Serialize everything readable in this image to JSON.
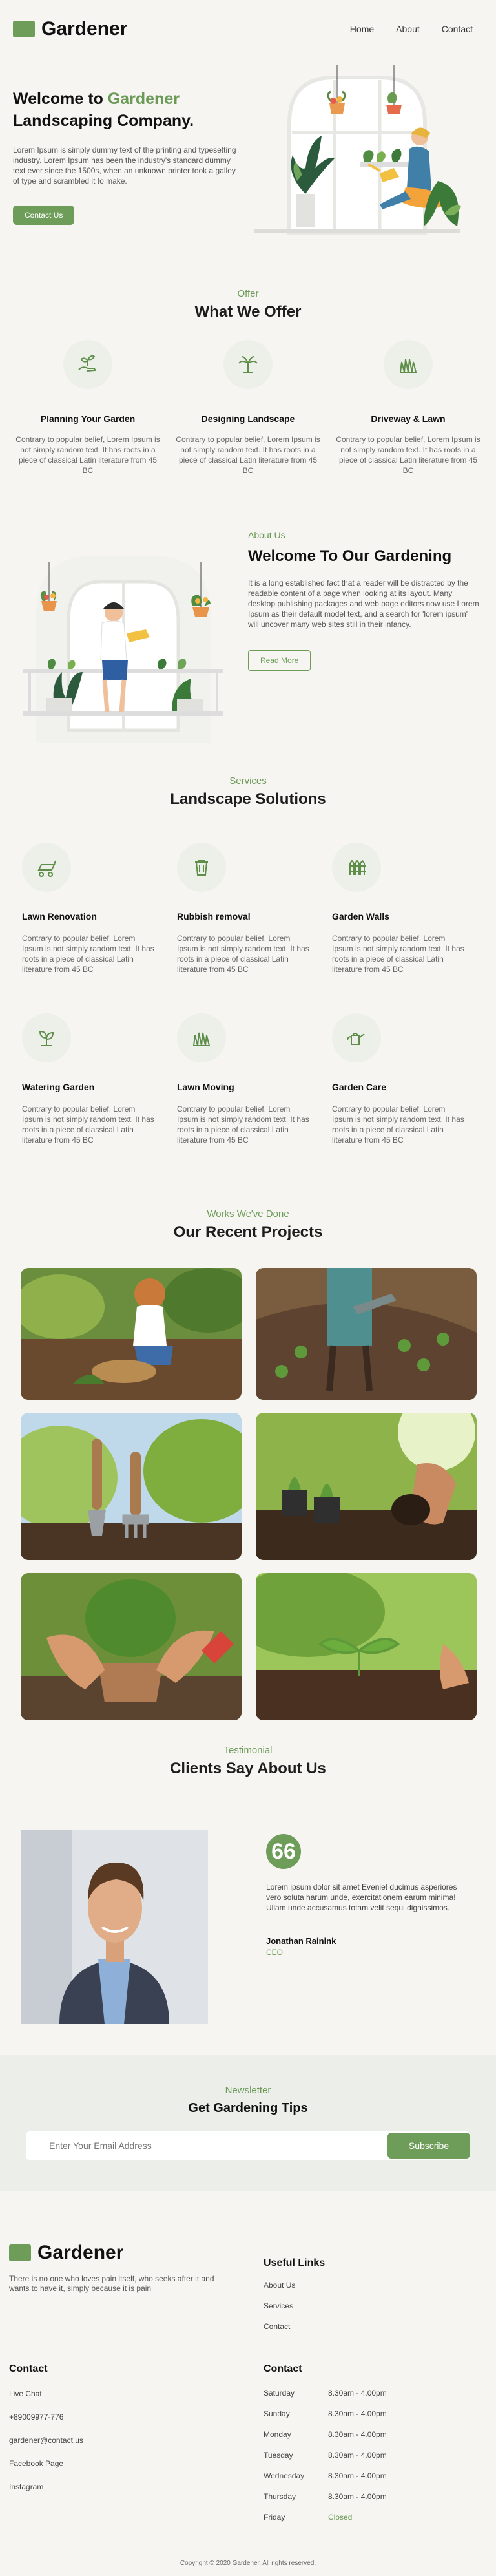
{
  "header": {
    "brand": "Gardener",
    "nav": [
      "Home",
      "About",
      "Contact"
    ]
  },
  "hero": {
    "title_prefix": "Welcome to ",
    "title_accent": "Gardener",
    "title_suffix": "Landscaping Company.",
    "text": "Lorem Ipsum is simply dummy text of the printing and typesetting industry. Lorem Ipsum has been the industry's standard dummy text ever since the 1500s, when an unknown printer took a galley of type and scrambled it to make.",
    "cta": "Contact Us"
  },
  "offer": {
    "kicker": "Offer",
    "title": "What We Offer",
    "items": [
      {
        "icon": "planting-hand-icon",
        "title": "Planning Your Garden",
        "text": "Contrary to popular belief, Lorem Ipsum is not simply random text. It has roots in a piece of classical Latin literature from 45 BC"
      },
      {
        "icon": "palm-tree-icon",
        "title": "Designing Landscape",
        "text": "Contrary to popular belief, Lorem Ipsum is not simply random text. It has roots in a piece of classical Latin literature from 45 BC"
      },
      {
        "icon": "grass-icon",
        "title": "Driveway & Lawn",
        "text": "Contrary to popular belief, Lorem Ipsum is not simply random text. It has roots in a piece of classical Latin literature from 45 BC"
      }
    ]
  },
  "about": {
    "kicker": "About Us",
    "title": "Welcome To Our Gardening",
    "text": "It is a long established fact that a reader will be distracted by the readable content of a page when looking at its layout. Many desktop publishing packages and web page editors now use Lorem Ipsum as their default model text, and a search for 'lorem ipsum' will uncover many web sites still in their infancy.",
    "cta": "Read More"
  },
  "services": {
    "kicker": "Services",
    "title": "Landscape Solutions",
    "items": [
      {
        "icon": "lawn-mower-icon",
        "title": "Lawn Renovation",
        "text": "Contrary to popular belief, Lorem Ipsum is not simply random text. It has roots in a piece of classical Latin literature from 45 BC"
      },
      {
        "icon": "trash-bin-icon",
        "title": "Rubbish removal",
        "text": "Contrary to popular belief, Lorem Ipsum is not simply random text. It has roots in a piece of classical Latin literature from 45 BC"
      },
      {
        "icon": "garden-fence-icon",
        "title": "Garden Walls",
        "text": "Contrary to popular belief, Lorem Ipsum is not simply random text. It has roots in a piece of classical Latin literature from 45 BC"
      },
      {
        "icon": "sprout-icon",
        "title": "Watering Garden",
        "text": "Contrary to popular belief, Lorem Ipsum is not simply random text. It has roots in a piece of classical Latin literature from 45 BC"
      },
      {
        "icon": "grass-icon",
        "title": "Lawn Moving",
        "text": "Contrary to popular belief, Lorem Ipsum is not simply random text. It has roots in a piece of classical Latin literature from 45 BC"
      },
      {
        "icon": "watering-can-icon",
        "title": "Garden Care",
        "text": "Contrary to popular belief, Lorem Ipsum is not simply random text. It has roots in a piece of classical Latin literature from 45 BC"
      }
    ]
  },
  "projects": {
    "kicker": "Works We've Done",
    "title": "Our Recent Projects",
    "photos": [
      "child-gardening-photo",
      "watering-seedlings-photo",
      "garden-tools-photo",
      "planting-hands-photo",
      "potted-plant-photo",
      "seedling-photo"
    ]
  },
  "testimonial": {
    "kicker": "Testimonial",
    "title": "Clients Say About Us",
    "quote_mark": "66",
    "text": "Lorem ipsum dolor sit amet Eveniet ducimus asperiores vero soluta harum unde, exercitationem earum minima! Ullam unde accusamus totam velit sequi dignissimos.",
    "name": "Jonathan Rainink",
    "role": "CEO"
  },
  "newsletter": {
    "kicker": "Newsletter",
    "title": "Get Gardening Tips",
    "placeholder": "Enter Your Email Address",
    "cta": "Subscribe"
  },
  "footer": {
    "brand": "Gardener",
    "desc": "There is no one who loves pain itself, who seeks after it and wants to have it, simply because it is pain",
    "links_title": "Useful Links",
    "links": [
      "About Us",
      "Services",
      "Contact"
    ],
    "contact_title": "Contact",
    "contact": [
      "Live Chat",
      "+89009977-776",
      "gardener@contact.us",
      "Facebook Page",
      "Instagram"
    ],
    "hours_title": "Contact",
    "hours": [
      {
        "day": "Saturday",
        "time": "8.30am - 4.00pm"
      },
      {
        "day": "Sunday",
        "time": "8.30am - 4.00pm"
      },
      {
        "day": "Monday",
        "time": "8.30am - 4.00pm"
      },
      {
        "day": "Tuesday",
        "time": "8.30am - 4.00pm"
      },
      {
        "day": "Wednesday",
        "time": "8.30am - 4.00pm"
      },
      {
        "day": "Thursday",
        "time": "8.30am - 4.00pm"
      },
      {
        "day": "Friday",
        "time": "Closed"
      }
    ],
    "copyright": "Copyright © 2020 Gardener. All rights reserved."
  },
  "colors": {
    "accent": "#6e9d5a",
    "background": "#f6f5f2",
    "icon_bg": "#edf0e9"
  }
}
